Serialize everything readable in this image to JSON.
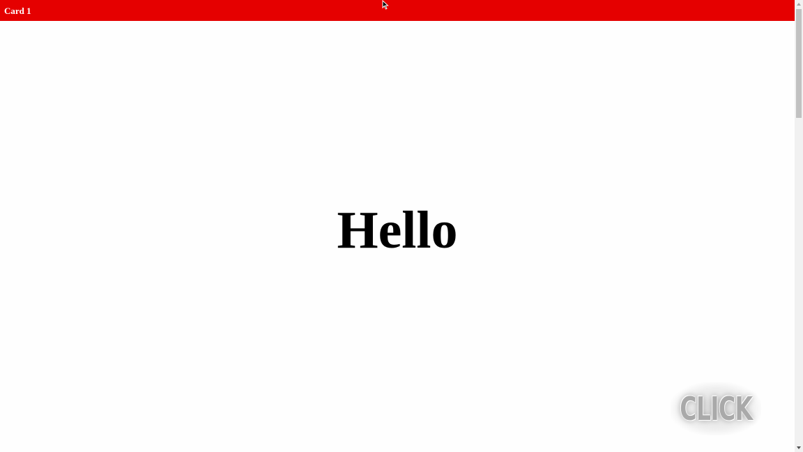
{
  "card": {
    "title": "Card 1",
    "header_color": "#e50000"
  },
  "main": {
    "heading": "Hello"
  },
  "overlay": {
    "click_label": "CLICK"
  },
  "icons": {
    "cursor": "mouse-pointer-icon",
    "scroll_up": "chevron-up-icon",
    "scroll_down": "chevron-down-icon"
  }
}
